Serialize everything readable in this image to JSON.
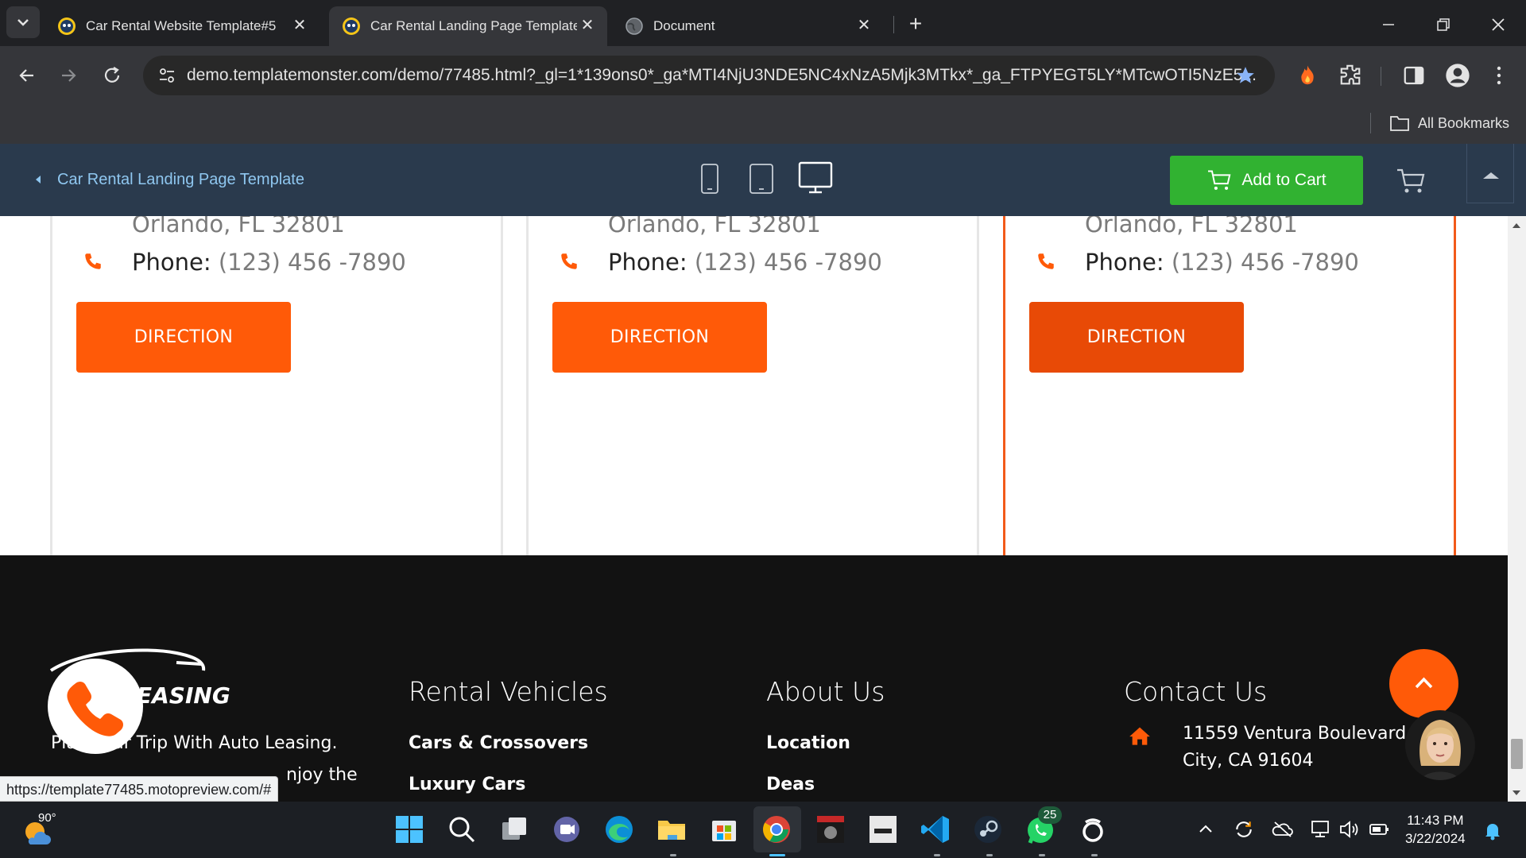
{
  "browser": {
    "tabs": [
      {
        "title": "Car Rental Website Template#5"
      },
      {
        "title": "Car Rental Landing Page Template"
      },
      {
        "title": "Document"
      }
    ],
    "url": "demo.templatemonster.com/demo/77485.html?_gl=1*139ons0*_ga*MTI4NjU3NDE5NC4xNzA5Mjk3MTkx*_ga_FTPYEGT5LY*MTcwOTI5NzE5...",
    "bookmarks_label": "All Bookmarks",
    "status_url": "https://template77485.motopreview.com/#"
  },
  "tm_bar": {
    "title": "Car Rental Landing Page Template",
    "add_to_cart": "Add to Cart"
  },
  "locations": [
    {
      "city": "Orlando, FL 32801",
      "phone_label": "Phone:",
      "phone": "(123) 456 -7890",
      "button": "DIRECTION"
    },
    {
      "city": "Orlando, FL 32801",
      "phone_label": "Phone:",
      "phone": "(123) 456 -7890",
      "button": "DIRECTION"
    },
    {
      "city": "Orlando, FL 32801",
      "phone_label": "Phone:",
      "phone": "(123) 456 -7890",
      "button": "DIRECTION"
    }
  ],
  "footer": {
    "logo_text": "EASING",
    "tagline": "Plan Your Trip With Auto Leasing.",
    "tagline2": "njoy the",
    "columns": [
      {
        "heading": "Rental Vehicles",
        "links": [
          "Cars & Crossovers",
          "Luxury Cars"
        ]
      },
      {
        "heading": "About Us",
        "links": [
          "Location",
          "Deas"
        ]
      },
      {
        "heading": "Contact Us"
      }
    ],
    "address_line1": "11559 Ventura Boulevard, S",
    "address_line2": "City, CA 91604"
  },
  "taskbar": {
    "temperature": "90°",
    "time": "11:43 PM",
    "date": "3/22/2024",
    "whatsapp_badge": "25"
  },
  "colors": {
    "accent": "#ff5a08",
    "cart_green": "#31b231",
    "tm_bar": "#2a3a4d"
  }
}
